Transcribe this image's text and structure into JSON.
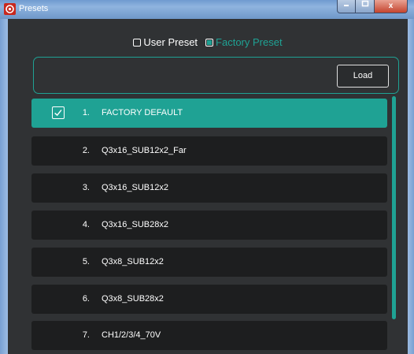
{
  "window": {
    "title": "Presets",
    "close_glyph": "x"
  },
  "colors": {
    "accent": "#1fa294",
    "background": "#303234",
    "item_bg": "#1d1e1f",
    "text": "#ffffff"
  },
  "mode": {
    "user_label": "User Preset",
    "factory_label": "Factory Preset",
    "selected": "factory"
  },
  "toolbar": {
    "load_label": "Load"
  },
  "presets": [
    {
      "num": "1.",
      "name": "FACTORY DEFAULT",
      "selected": true
    },
    {
      "num": "2.",
      "name": "Q3x16_SUB12x2_Far",
      "selected": false
    },
    {
      "num": "3.",
      "name": "Q3x16_SUB12x2",
      "selected": false
    },
    {
      "num": "4.",
      "name": "Q3x16_SUB28x2",
      "selected": false
    },
    {
      "num": "5.",
      "name": "Q3x8_SUB12x2",
      "selected": false
    },
    {
      "num": "6.",
      "name": "Q3x8_SUB28x2",
      "selected": false
    },
    {
      "num": "7.",
      "name": "CH1/2/3/4_70V",
      "selected": false
    }
  ]
}
